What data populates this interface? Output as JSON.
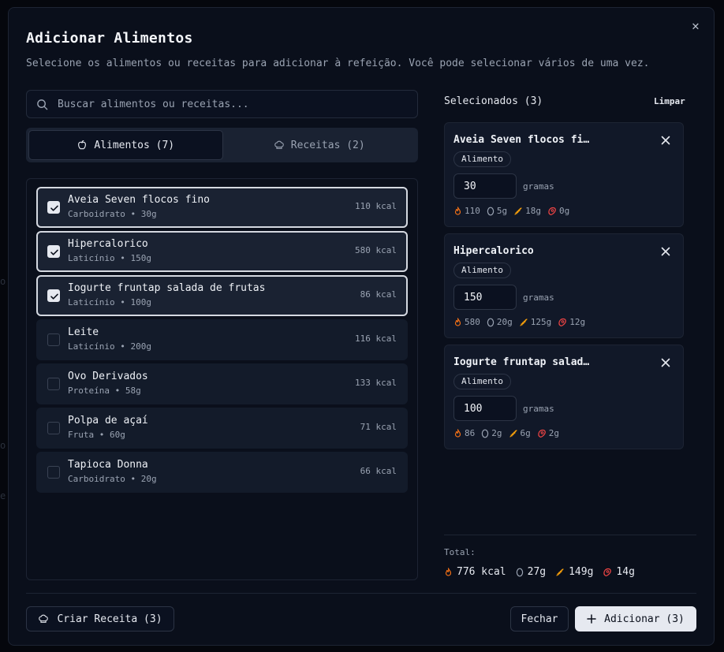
{
  "dialog": {
    "title": "Adicionar Alimentos",
    "subtitle": "Selecione os alimentos ou receitas para adicionar à refeição. Você pode selecionar vários de uma vez.",
    "close_icon": "close-icon"
  },
  "search": {
    "placeholder": "Buscar alimentos ou receitas...",
    "value": ""
  },
  "tabs": [
    {
      "label": "Alimentos (7)",
      "icon": "apple-icon",
      "active": true
    },
    {
      "label": "Receitas (2)",
      "icon": "chef-hat-icon",
      "active": false
    }
  ],
  "foods": [
    {
      "name": "Aveia Seven flocos fino",
      "meta": "Carboidrato • 30g",
      "kcal": "110 kcal",
      "selected": true
    },
    {
      "name": "Hipercalorico",
      "meta": "Laticínio • 150g",
      "kcal": "580 kcal",
      "selected": true
    },
    {
      "name": "Iogurte fruntap salada de frutas",
      "meta": "Laticínio • 100g",
      "kcal": "86 kcal",
      "selected": true
    },
    {
      "name": "Leite",
      "meta": "Laticínio • 200g",
      "kcal": "116 kcal",
      "selected": false
    },
    {
      "name": "Ovo Derivados",
      "meta": "Proteína • 58g",
      "kcal": "133 kcal",
      "selected": false
    },
    {
      "name": "Polpa de açaí",
      "meta": "Fruta • 60g",
      "kcal": "71 kcal",
      "selected": false
    },
    {
      "name": "Tapioca Donna",
      "meta": "Carboidrato • 20g",
      "kcal": "66 kcal",
      "selected": false
    }
  ],
  "selected_panel": {
    "title": "Selecionados (3)",
    "clear_label": "Limpar",
    "items": [
      {
        "name": "Aveia Seven flocos fi…",
        "badge": "Alimento",
        "grams": "30",
        "unit": "gramas",
        "kcal": "110",
        "fat": "5g",
        "carbs": "18g",
        "protein": "0g"
      },
      {
        "name": "Hipercalorico",
        "badge": "Alimento",
        "grams": "150",
        "unit": "gramas",
        "kcal": "580",
        "fat": "20g",
        "carbs": "125g",
        "protein": "12g"
      },
      {
        "name": "Iogurte fruntap salad…",
        "badge": "Alimento",
        "grams": "100",
        "unit": "gramas",
        "kcal": "86",
        "fat": "2g",
        "carbs": "6g",
        "protein": "2g"
      }
    ],
    "total_label": "Total:",
    "total": {
      "kcal": "776 kcal",
      "fat": "27g",
      "carbs": "149g",
      "protein": "14g"
    }
  },
  "footer": {
    "create_recipe_label": "Criar Receita (3)",
    "close_label": "Fechar",
    "add_label": "Adicionar (3)"
  },
  "colors": {
    "kcal": "#f97316",
    "carbs": "#f59e0b",
    "protein": "#ef4444",
    "fat": "#9aa3b2"
  }
}
